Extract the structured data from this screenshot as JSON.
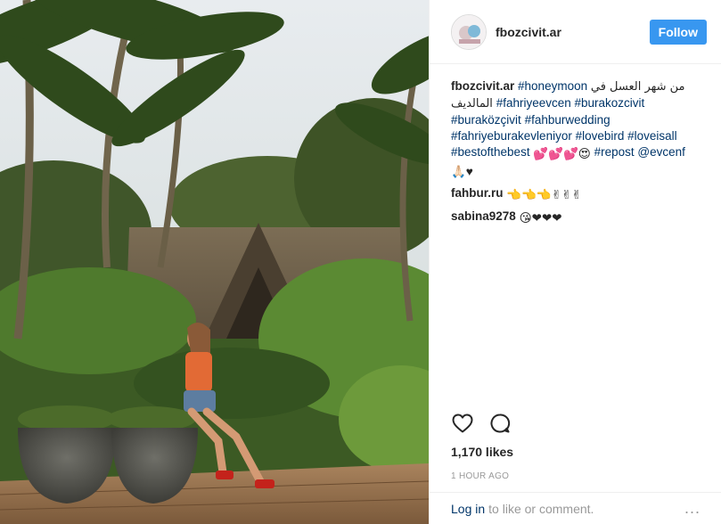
{
  "post": {
    "username": "fbozcivit.ar",
    "follow_label": "Follow"
  },
  "caption": {
    "author": "fbozcivit.ar",
    "hashtag_1": "#honeymoon",
    "arabic": "من شهر العسل في المالديف",
    "hashtag_2": "#fahriyeevcen",
    "hashtag_3": "#burakozcivit",
    "hashtag_4": "#buraközçivit",
    "hashtag_5": "#fahburwedding",
    "hashtag_6": "#fahriyeburakevleniyor",
    "hashtag_7": "#lovebird",
    "hashtag_8": "#loveisall",
    "hashtag_9": "#bestofthebest",
    "hashtag_10": "#repost",
    "mention": "@evcenf",
    "emoji_1": "💕💕💕😍",
    "emoji_2": "🙏🏻♥"
  },
  "comments": [
    {
      "author": "fahbur.ru",
      "text": "👈👈👈✌✌✌"
    },
    {
      "author": "sabina9278",
      "text": "😘❤❤❤"
    }
  ],
  "actions": {
    "like_icon": "heart-icon",
    "comment_icon": "comment-icon",
    "likes": "1,170 likes",
    "time": "1 HOUR AGO"
  },
  "login": {
    "link": "Log in",
    "rest": "to like or comment.",
    "more": "..."
  },
  "colors": {
    "follow_bg": "#3897f0",
    "link": "#003569",
    "muted": "#999999"
  }
}
